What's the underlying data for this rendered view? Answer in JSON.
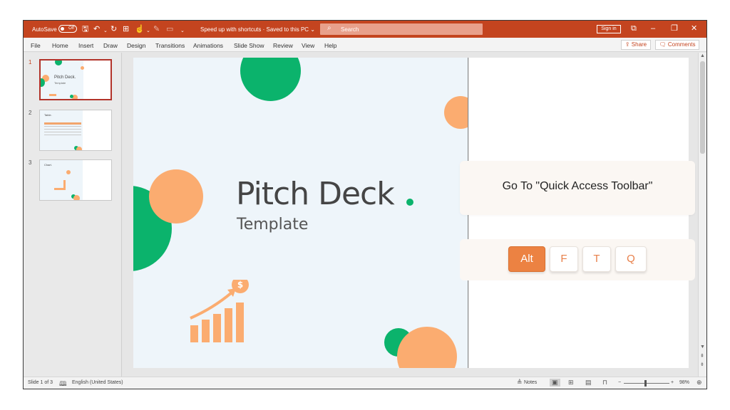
{
  "titlebar": {
    "autosave_label": "AutoSave",
    "autosave_state": "Off",
    "document_title": "Speed up with shortcuts · Saved to this PC ⌄",
    "search_placeholder": "Search",
    "sign_in_label": "Sign in",
    "icons": [
      "save-icon",
      "undo-icon",
      "redo-icon",
      "present-icon",
      "customize-icon"
    ]
  },
  "menubar": {
    "items": [
      "File",
      "Home",
      "Insert",
      "Draw",
      "Design",
      "Transitions",
      "Animations",
      "Slide Show",
      "Review",
      "View",
      "Help"
    ],
    "share_label": "Share",
    "comments_label": "Comments"
  },
  "thumbnails": [
    {
      "number": "1",
      "title": "Pitch Deck.",
      "subtitle": "Template"
    },
    {
      "number": "2",
      "title": "Table."
    },
    {
      "number": "3",
      "title": "Chart."
    }
  ],
  "slide": {
    "title": "Pitch Deck",
    "subtitle": "Template",
    "coin_symbol": "$",
    "colors": {
      "green": "#0bb36c",
      "orange": "#fbac70",
      "background": "#eef5fa"
    }
  },
  "overlay": {
    "instruction": "Go To \"Quick Access Toolbar\"",
    "keys": [
      "Alt",
      "F",
      "T",
      "Q"
    ],
    "accent": "#ec8242"
  },
  "statusbar": {
    "slide_counter": "Slide 1 of 3",
    "language": "English (United States)",
    "notes_label": "Notes",
    "zoom_level": "98%"
  }
}
